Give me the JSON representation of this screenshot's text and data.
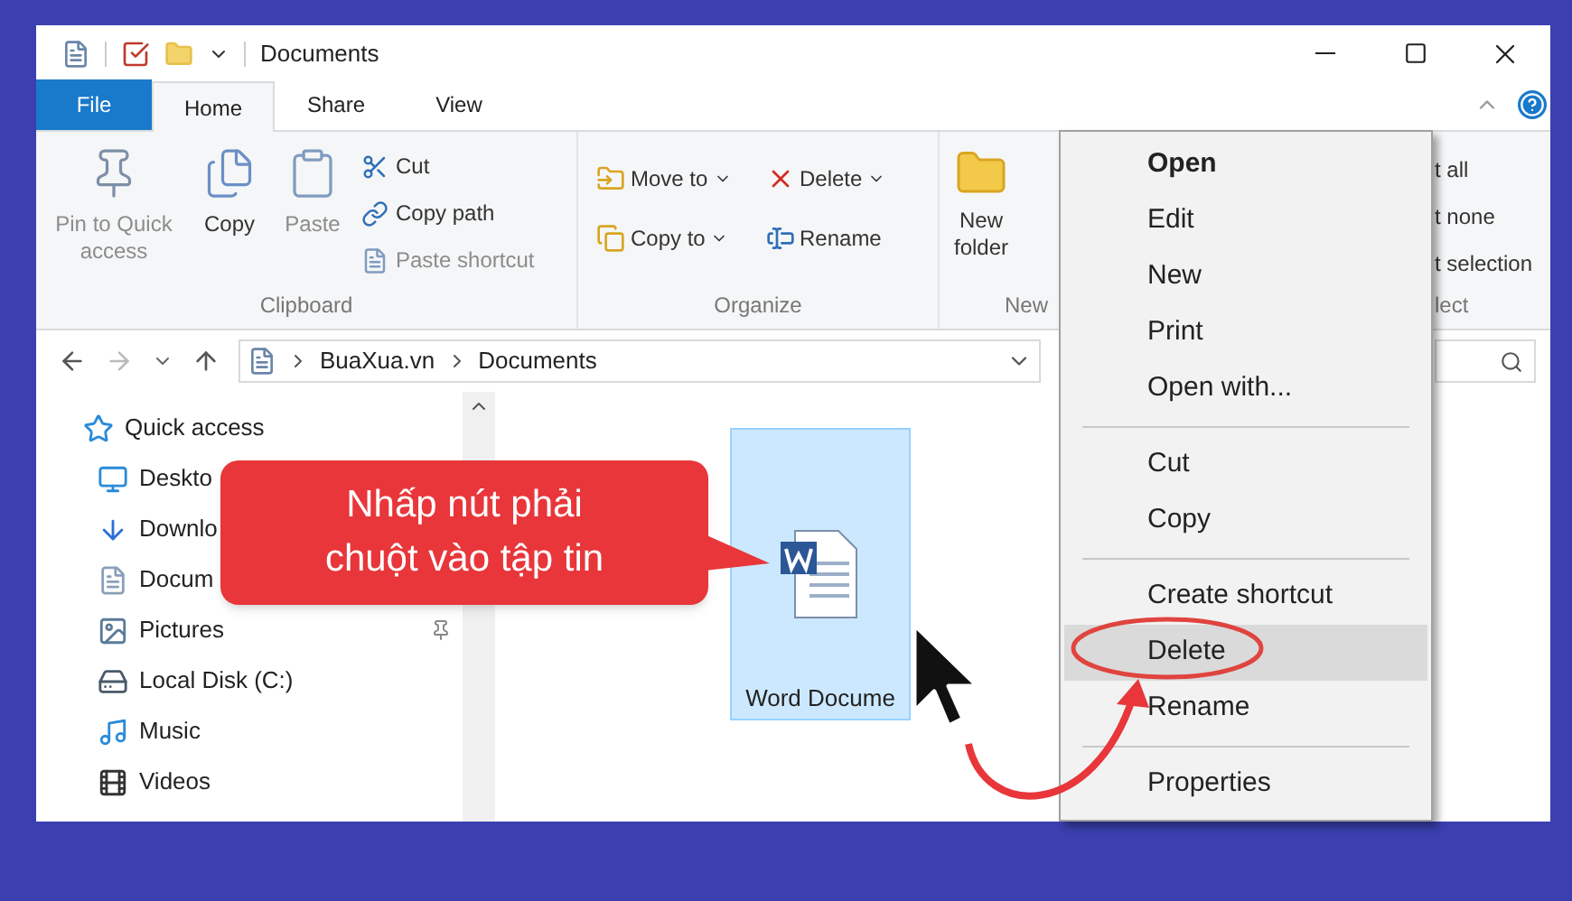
{
  "window": {
    "title": "Documents"
  },
  "tabs": [
    {
      "label": "File",
      "kind": "file",
      "selected": false
    },
    {
      "label": "Home",
      "kind": "tab",
      "selected": true
    },
    {
      "label": "Share",
      "kind": "tab",
      "selected": false
    },
    {
      "label": "View",
      "kind": "tab",
      "selected": false
    }
  ],
  "ribbon": {
    "clipboard": {
      "label": "Clipboard",
      "large": [
        {
          "label": "Pin to Quick access",
          "disabled": true
        },
        {
          "label": "Copy",
          "disabled": false
        },
        {
          "label": "Paste",
          "disabled": true
        }
      ],
      "small": [
        {
          "label": "Cut",
          "disabled": false
        },
        {
          "label": "Copy path",
          "disabled": false
        },
        {
          "label": "Paste shortcut",
          "disabled": true
        }
      ]
    },
    "organize": {
      "label": "Organize",
      "items": [
        {
          "label": "Move to",
          "has_menu": true
        },
        {
          "label": "Copy to",
          "has_menu": true
        },
        {
          "label": "Delete",
          "has_menu": true
        },
        {
          "label": "Rename",
          "has_menu": false
        }
      ]
    },
    "new": {
      "label": "New",
      "large": [
        {
          "label": "New folder"
        }
      ]
    },
    "select_fragment": {
      "items": [
        "t all",
        "t none",
        "t selection"
      ],
      "label": "lect"
    }
  },
  "address": {
    "path": [
      "BuaXua.vn",
      "Documents"
    ]
  },
  "nav": [
    {
      "label": "Quick access",
      "pinned": false
    },
    {
      "label": "Deskto"
    },
    {
      "label": "Downlo"
    },
    {
      "label": "Docum"
    },
    {
      "label": "Pictures",
      "pinned": true
    },
    {
      "label": "Local Disk (C:)",
      "pinned": false
    },
    {
      "label": "Music",
      "pinned": false
    },
    {
      "label": "Videos",
      "pinned": false
    }
  ],
  "files": [
    {
      "name": "Word Docume",
      "selected": true
    }
  ],
  "context_menu": [
    {
      "kind": "item",
      "label": "Open",
      "default": true,
      "selected": false
    },
    {
      "kind": "item",
      "label": "Edit",
      "default": false,
      "selected": false
    },
    {
      "kind": "item",
      "label": "New",
      "default": false,
      "selected": false
    },
    {
      "kind": "item",
      "label": "Print",
      "default": false,
      "selected": false
    },
    {
      "kind": "item",
      "label": "Open with...",
      "default": false,
      "selected": false
    },
    {
      "kind": "separator"
    },
    {
      "kind": "item",
      "label": "Cut",
      "default": false,
      "selected": false
    },
    {
      "kind": "item",
      "label": "Copy",
      "default": false,
      "selected": false
    },
    {
      "kind": "separator"
    },
    {
      "kind": "item",
      "label": "Create shortcut",
      "default": false,
      "selected": false
    },
    {
      "kind": "item",
      "label": "Delete",
      "default": false,
      "selected": true
    },
    {
      "kind": "item",
      "label": "Rename",
      "default": false,
      "selected": false
    },
    {
      "kind": "separator"
    },
    {
      "kind": "item",
      "label": "Properties",
      "default": false,
      "selected": false
    }
  ],
  "annotation": {
    "callout": "Nhấp nút phải chuột vào tập tin"
  }
}
